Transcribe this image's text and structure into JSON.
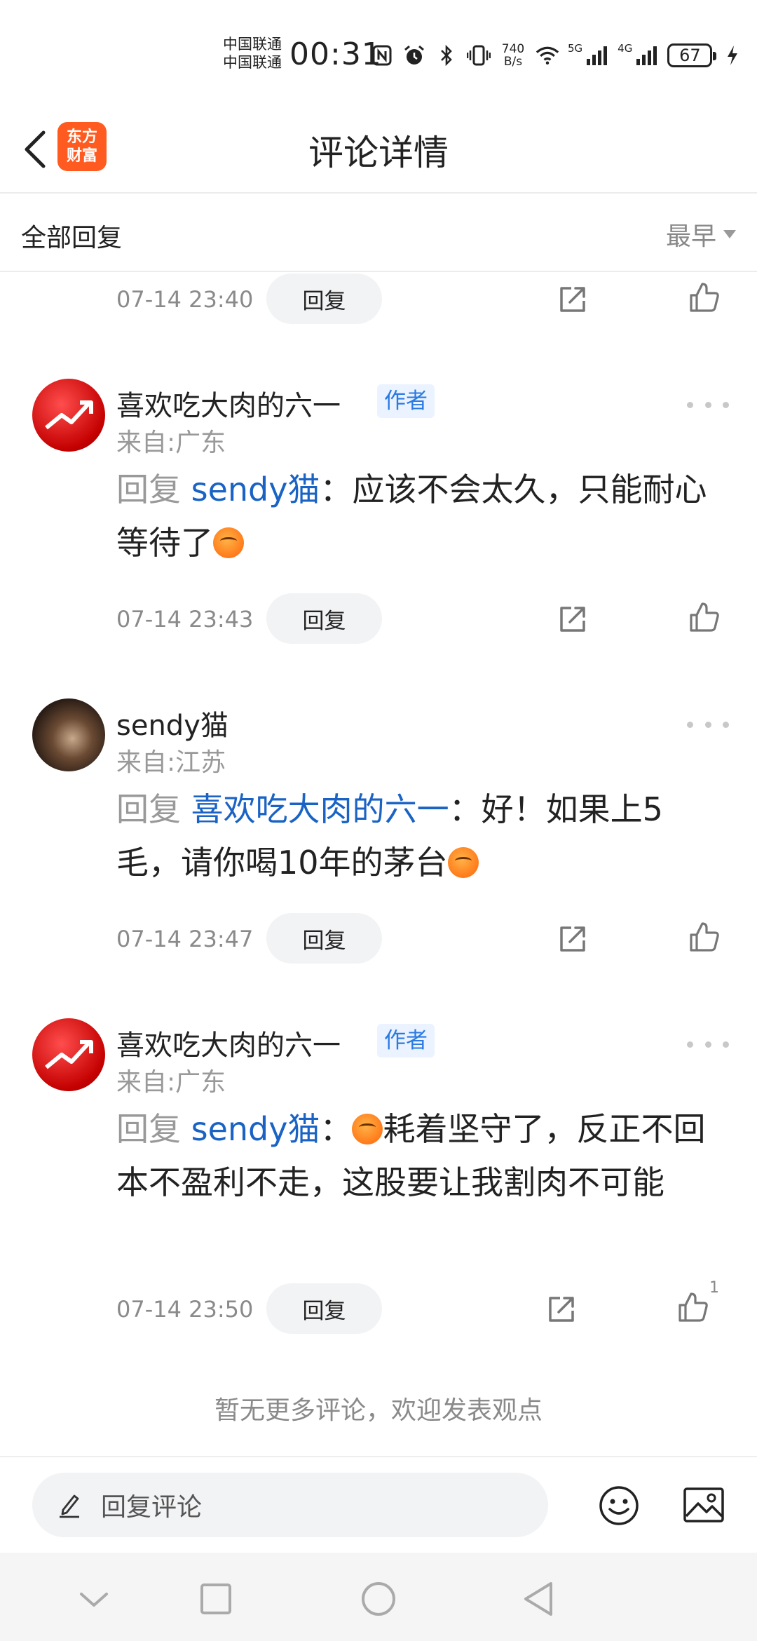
{
  "status_bar": {
    "carrier_1": "中国联通",
    "carrier_2": "中国联通",
    "time": "00:31",
    "net_speed_value": "740",
    "net_speed_unit": "B/s",
    "signal_1_label": "5G",
    "signal_2_label": "4G",
    "battery": "67",
    "icons": [
      "nfc-icon",
      "alarm-icon",
      "bluetooth-icon",
      "vibrate-icon",
      "wifi-icon",
      "signal-icon",
      "charging-icon"
    ]
  },
  "header": {
    "title": "评论详情",
    "logo_line1": "东方",
    "logo_line2": "财富"
  },
  "sort_bar": {
    "label": "全部回复",
    "sort_option": "最早"
  },
  "top_partial": {
    "time": "07-14 23:40",
    "reply_label": "回复"
  },
  "comments": [
    {
      "user": "喜欢吃大肉的六一",
      "badge": "作者",
      "location": "来自:广东",
      "reply_word": "回复",
      "mention": "sendy猫",
      "separator": "：",
      "text": "应该不会太久，只能耐心等待了",
      "time": "07-14 23:43",
      "reply_label": "回复"
    },
    {
      "user": "sendy猫",
      "location": "来自:江苏",
      "reply_word": "回复",
      "mention": "喜欢吃大肉的六一",
      "separator": "：",
      "text": "好！如果上5毛，请你喝10年的茅台",
      "time": "07-14 23:47",
      "reply_label": "回复"
    },
    {
      "user": "喜欢吃大肉的六一",
      "badge": "作者",
      "location": "来自:广东",
      "reply_word": "回复",
      "mention": "sendy猫",
      "separator": "：",
      "text": "耗着坚守了，反正不回本不盈利不走，这股要让我割肉不可能",
      "time": "07-14 23:50",
      "reply_label": "回复",
      "likes": "1"
    }
  ],
  "footer_note": "暂无更多评论，欢迎发表观点",
  "bottom_bar": {
    "reply_placeholder": "回复评论"
  },
  "colors": {
    "mention": "#1a63c5",
    "badge_bg": "#eaf3ff",
    "badge_text": "#2a7ae2",
    "logo": "#ff5a1f"
  }
}
